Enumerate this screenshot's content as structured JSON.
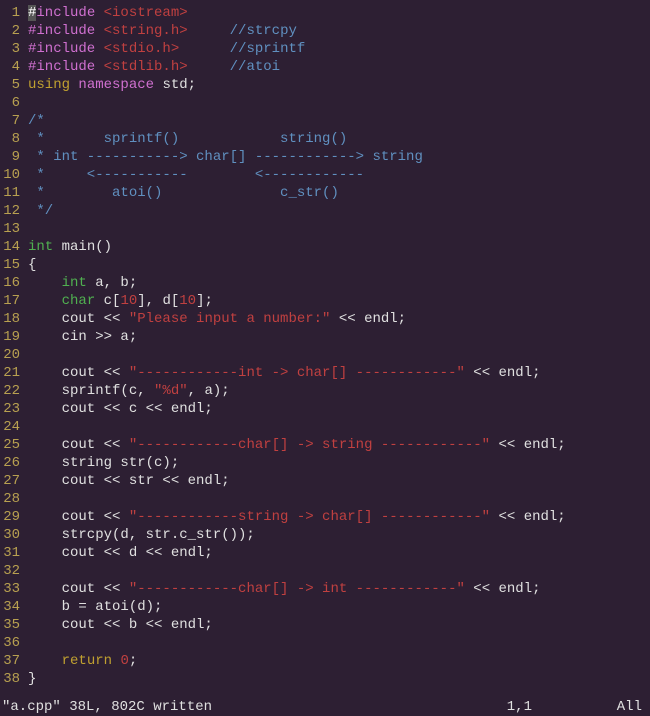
{
  "status": {
    "filename": "\"a.cpp\" 38L, 802C written",
    "position": "1,1",
    "scroll": "All"
  },
  "lines": [
    {
      "n": "1",
      "tokens": [
        {
          "c": "cursor",
          "t": "#"
        },
        {
          "c": "preproc",
          "t": "include "
        },
        {
          "c": "string",
          "t": "<iostream>"
        }
      ]
    },
    {
      "n": "2",
      "tokens": [
        {
          "c": "preproc",
          "t": "#include "
        },
        {
          "c": "string",
          "t": "<string.h>"
        },
        {
          "c": "",
          "t": "     "
        },
        {
          "c": "comment",
          "t": "//strcpy"
        }
      ]
    },
    {
      "n": "3",
      "tokens": [
        {
          "c": "preproc",
          "t": "#include "
        },
        {
          "c": "string",
          "t": "<stdio.h>"
        },
        {
          "c": "",
          "t": "      "
        },
        {
          "c": "comment",
          "t": "//sprintf"
        }
      ]
    },
    {
      "n": "4",
      "tokens": [
        {
          "c": "preproc",
          "t": "#include "
        },
        {
          "c": "string",
          "t": "<stdlib.h>"
        },
        {
          "c": "",
          "t": "     "
        },
        {
          "c": "comment",
          "t": "//atoi"
        }
      ]
    },
    {
      "n": "5",
      "tokens": [
        {
          "c": "keyword",
          "t": "using"
        },
        {
          "c": "",
          "t": " "
        },
        {
          "c": "namespace",
          "t": "namespace"
        },
        {
          "c": "",
          "t": " "
        },
        {
          "c": "ident",
          "t": "std;"
        }
      ]
    },
    {
      "n": "6",
      "tokens": []
    },
    {
      "n": "7",
      "tokens": [
        {
          "c": "comment",
          "t": "/*"
        }
      ]
    },
    {
      "n": "8",
      "tokens": [
        {
          "c": "comment",
          "t": " *       sprintf()            string()"
        }
      ]
    },
    {
      "n": "9",
      "tokens": [
        {
          "c": "comment",
          "t": " * int -----------> char[] ------------> string"
        }
      ]
    },
    {
      "n": "10",
      "tokens": [
        {
          "c": "comment",
          "t": " *     <-----------        <------------"
        }
      ]
    },
    {
      "n": "11",
      "tokens": [
        {
          "c": "comment",
          "t": " *        atoi()              c_str()"
        }
      ]
    },
    {
      "n": "12",
      "tokens": [
        {
          "c": "comment",
          "t": " */"
        }
      ]
    },
    {
      "n": "13",
      "tokens": []
    },
    {
      "n": "14",
      "tokens": [
        {
          "c": "type",
          "t": "int"
        },
        {
          "c": "",
          "t": " "
        },
        {
          "c": "ident",
          "t": "main()"
        }
      ]
    },
    {
      "n": "15",
      "tokens": [
        {
          "c": "",
          "t": "{"
        }
      ]
    },
    {
      "n": "16",
      "tokens": [
        {
          "c": "",
          "t": "    "
        },
        {
          "c": "type",
          "t": "int"
        },
        {
          "c": "",
          "t": " a, b;"
        }
      ]
    },
    {
      "n": "17",
      "tokens": [
        {
          "c": "",
          "t": "    "
        },
        {
          "c": "type",
          "t": "char"
        },
        {
          "c": "",
          "t": " c["
        },
        {
          "c": "number",
          "t": "10"
        },
        {
          "c": "",
          "t": "], d["
        },
        {
          "c": "number",
          "t": "10"
        },
        {
          "c": "",
          "t": "];"
        }
      ]
    },
    {
      "n": "18",
      "tokens": [
        {
          "c": "",
          "t": "    cout << "
        },
        {
          "c": "string",
          "t": "\"Please input a number:\""
        },
        {
          "c": "",
          "t": " << endl;"
        }
      ]
    },
    {
      "n": "19",
      "tokens": [
        {
          "c": "",
          "t": "    cin >> a;"
        }
      ]
    },
    {
      "n": "20",
      "tokens": []
    },
    {
      "n": "21",
      "tokens": [
        {
          "c": "",
          "t": "    cout << "
        },
        {
          "c": "string",
          "t": "\"------------int -> char[] ------------\""
        },
        {
          "c": "",
          "t": " << endl;"
        }
      ]
    },
    {
      "n": "22",
      "tokens": [
        {
          "c": "",
          "t": "    sprintf(c, "
        },
        {
          "c": "string",
          "t": "\"%d\""
        },
        {
          "c": "",
          "t": ", a);"
        }
      ]
    },
    {
      "n": "23",
      "tokens": [
        {
          "c": "",
          "t": "    cout << c << endl;"
        }
      ]
    },
    {
      "n": "24",
      "tokens": []
    },
    {
      "n": "25",
      "tokens": [
        {
          "c": "",
          "t": "    cout << "
        },
        {
          "c": "string",
          "t": "\"------------char[] -> string ------------\""
        },
        {
          "c": "",
          "t": " << endl;"
        }
      ]
    },
    {
      "n": "26",
      "tokens": [
        {
          "c": "",
          "t": "    string str(c);"
        }
      ]
    },
    {
      "n": "27",
      "tokens": [
        {
          "c": "",
          "t": "    cout << str << endl;"
        }
      ]
    },
    {
      "n": "28",
      "tokens": []
    },
    {
      "n": "29",
      "tokens": [
        {
          "c": "",
          "t": "    cout << "
        },
        {
          "c": "string",
          "t": "\"------------string -> char[] ------------\""
        },
        {
          "c": "",
          "t": " << endl;"
        }
      ]
    },
    {
      "n": "30",
      "tokens": [
        {
          "c": "",
          "t": "    strcpy(d, str.c_str());"
        }
      ]
    },
    {
      "n": "31",
      "tokens": [
        {
          "c": "",
          "t": "    cout << d << endl;"
        }
      ]
    },
    {
      "n": "32",
      "tokens": []
    },
    {
      "n": "33",
      "tokens": [
        {
          "c": "",
          "t": "    cout << "
        },
        {
          "c": "string",
          "t": "\"------------char[] -> int ------------\""
        },
        {
          "c": "",
          "t": " << endl;"
        }
      ]
    },
    {
      "n": "34",
      "tokens": [
        {
          "c": "",
          "t": "    b = atoi(d);"
        }
      ]
    },
    {
      "n": "35",
      "tokens": [
        {
          "c": "",
          "t": "    cout << b << endl;"
        }
      ]
    },
    {
      "n": "36",
      "tokens": []
    },
    {
      "n": "37",
      "tokens": [
        {
          "c": "",
          "t": "    "
        },
        {
          "c": "keyword",
          "t": "return"
        },
        {
          "c": "",
          "t": " "
        },
        {
          "c": "number",
          "t": "0"
        },
        {
          "c": "",
          "t": ";"
        }
      ]
    },
    {
      "n": "38",
      "tokens": [
        {
          "c": "",
          "t": "}"
        }
      ]
    }
  ]
}
